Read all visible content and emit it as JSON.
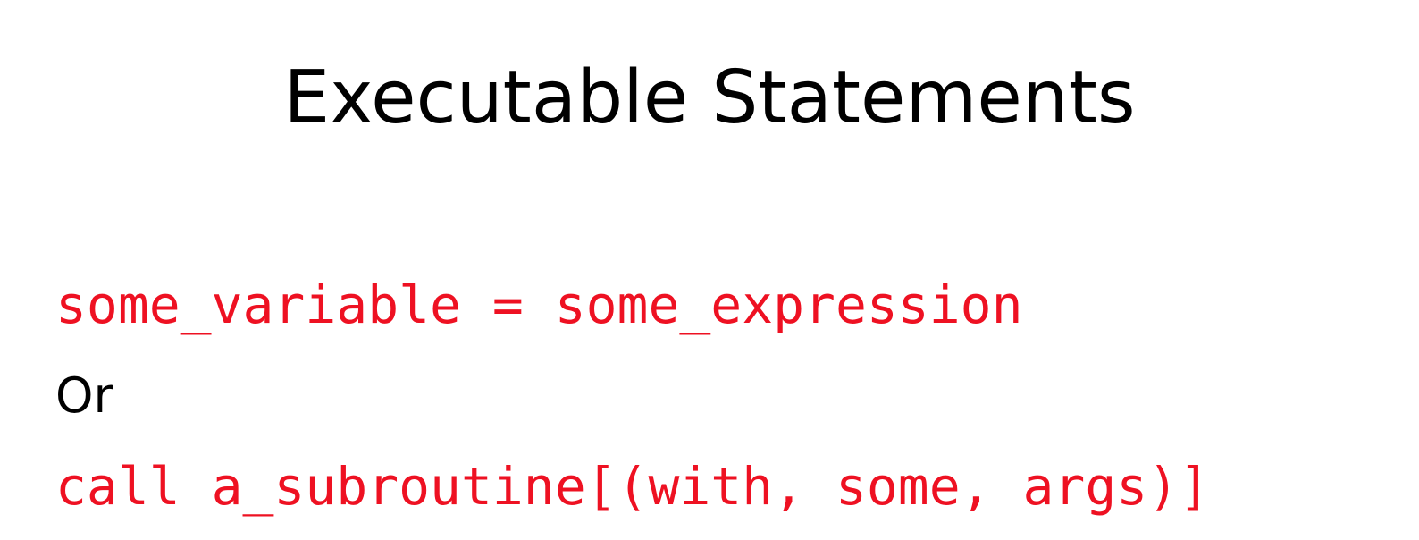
{
  "slide": {
    "title": "Executable Statements",
    "lines": [
      {
        "text": "some_variable = some_expression",
        "style": "code",
        "color": "#ee1122"
      },
      {
        "text": "Or",
        "style": "plain",
        "color": "#000000"
      },
      {
        "text": "call a_subroutine[(with, some, args)]",
        "style": "code",
        "color": "#ee1122"
      }
    ]
  }
}
